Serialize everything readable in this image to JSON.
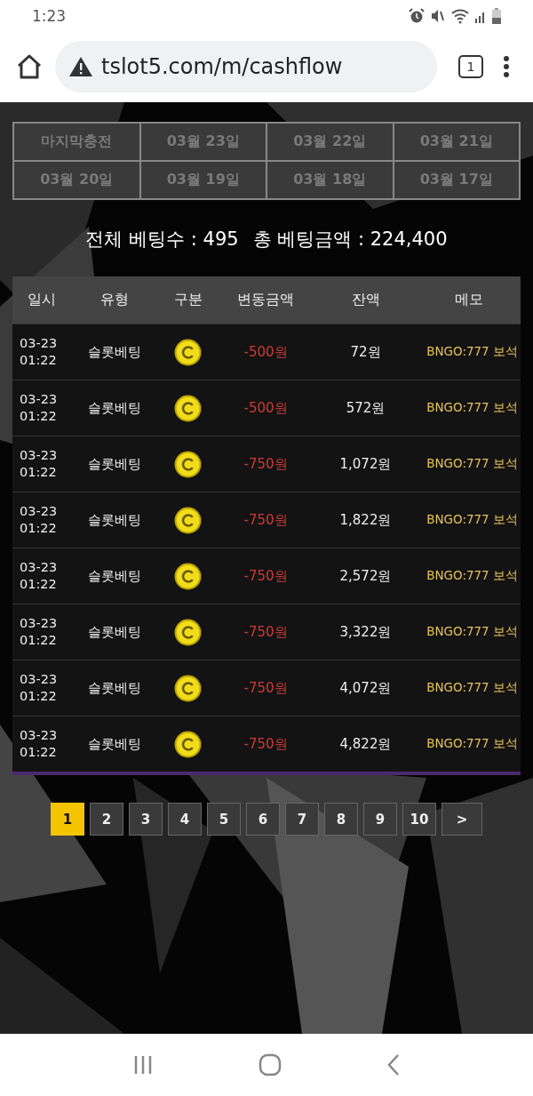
{
  "status_bar": {
    "time": "1:23"
  },
  "browser": {
    "url": "tslot5.com/m/cashflow",
    "tab_count": "1"
  },
  "date_filters": [
    {
      "label": "마지막충전",
      "selected": false
    },
    {
      "label": "03월 23일",
      "selected": false
    },
    {
      "label": "03월 22일",
      "selected": false
    },
    {
      "label": "03월 21일",
      "selected": false
    },
    {
      "label": "03월 20일",
      "selected": false
    },
    {
      "label": "03월 19일",
      "selected": false
    },
    {
      "label": "03월 18일",
      "selected": false
    },
    {
      "label": "03월 17일",
      "selected": false
    }
  ],
  "summary": {
    "count_label": "전체 베팅수 : 495",
    "amount_label": "총 베팅금액 : 224,400"
  },
  "table": {
    "columns": [
      "일시",
      "유형",
      "구분",
      "변동금액",
      "잔액",
      "메모"
    ],
    "rows": [
      {
        "date": "03-23",
        "time": "01:22",
        "type": "슬롯베팅",
        "amount": "-500원",
        "balance": "72원",
        "memo": "BNGO:777 보석"
      },
      {
        "date": "03-23",
        "time": "01:22",
        "type": "슬롯베팅",
        "amount": "-500원",
        "balance": "572원",
        "memo": "BNGO:777 보석"
      },
      {
        "date": "03-23",
        "time": "01:22",
        "type": "슬롯베팅",
        "amount": "-750원",
        "balance": "1,072원",
        "memo": "BNGO:777 보석"
      },
      {
        "date": "03-23",
        "time": "01:22",
        "type": "슬롯베팅",
        "amount": "-750원",
        "balance": "1,822원",
        "memo": "BNGO:777 보석"
      },
      {
        "date": "03-23",
        "time": "01:22",
        "type": "슬롯베팅",
        "amount": "-750원",
        "balance": "2,572원",
        "memo": "BNGO:777 보석"
      },
      {
        "date": "03-23",
        "time": "01:22",
        "type": "슬롯베팅",
        "amount": "-750원",
        "balance": "3,322원",
        "memo": "BNGO:777 보석"
      },
      {
        "date": "03-23",
        "time": "01:22",
        "type": "슬롯베팅",
        "amount": "-750원",
        "balance": "4,072원",
        "memo": "BNGO:777 보석"
      },
      {
        "date": "03-23",
        "time": "01:22",
        "type": "슬롯베팅",
        "amount": "-750원",
        "balance": "4,822원",
        "memo": "BNGO:777 보석"
      }
    ]
  },
  "pagination": [
    {
      "label": "1",
      "selected": true
    },
    {
      "label": "2",
      "selected": false
    },
    {
      "label": "3",
      "selected": false
    },
    {
      "label": "4",
      "selected": false
    },
    {
      "label": "5",
      "selected": false
    },
    {
      "label": "6",
      "selected": false
    },
    {
      "label": "7",
      "selected": false
    },
    {
      "label": "8",
      "selected": false
    },
    {
      "label": "9",
      "selected": false
    },
    {
      "label": "10",
      "selected": false
    },
    {
      "label": ">",
      "selected": false
    }
  ]
}
